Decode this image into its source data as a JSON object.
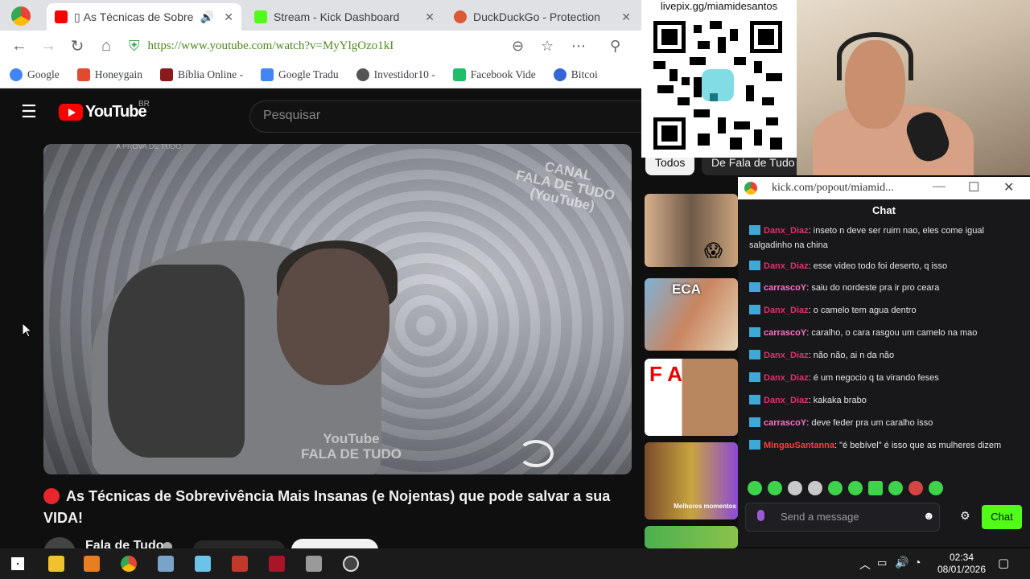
{
  "tabs": [
    {
      "title": "As Técnicas de Sobre",
      "prefix": "▯",
      "icon_color": "#ff0000",
      "active": true
    },
    {
      "title": "Stream - Kick Dashboard",
      "icon_color": "#53fc18"
    },
    {
      "title": "DuckDuckGo - Protection",
      "icon_color": "#de5833"
    }
  ],
  "address": {
    "url": "https://www.youtube.com/watch?v=MyYlgOzo1kI"
  },
  "bookmarks": [
    "Google",
    "Honeygain",
    "Bíblia Online -",
    "Google Tradu",
    "Investidor10 -",
    "Facebook Vide",
    "Bitcoi"
  ],
  "youtube": {
    "logo_text": "YouTube",
    "country": "BR",
    "search_placeholder": "Pesquisar",
    "video_title": "As Técnicas de Sobrevivência Mais Insanas (e Nojentas) que pode salvar a sua VIDA!",
    "channel_name": "Fala de Tudo",
    "watermark_top": "CANAL\nFALA DE TUDO\n(YouTube)",
    "watermark_bottom": "YouTube\nFALA DE TUDO",
    "watermark_corner": "A PROVA DE TUDO",
    "chips": [
      "Todos",
      "De Fala de Tudo"
    ],
    "thumb_labels": [
      "ECA",
      "F A",
      "Melhores momentos"
    ]
  },
  "overlay": {
    "livepix": "livepix.gg/miamidesantos"
  },
  "kick": {
    "url": "kick.com/popout/miamid...",
    "title": "Chat",
    "messages": [
      {
        "user": "Danx_Diaz",
        "color": "#e1306c",
        "text": "inseto n deve ser ruim nao, eles come igual salgadinho na china"
      },
      {
        "user": "Danx_Diaz",
        "color": "#e1306c",
        "text": "esse video todo foi deserto, q isso"
      },
      {
        "user": "carrascoY",
        "color": "#ff6ec7",
        "text": "saiu do nordeste pra ir pro ceara"
      },
      {
        "user": "Danx_Diaz",
        "color": "#e1306c",
        "text": "o camelo tem agua dentro"
      },
      {
        "user": "carrascoY",
        "color": "#ff6ec7",
        "text": "caralho, o cara rasgou um camelo na mao"
      },
      {
        "user": "Danx_Diaz",
        "color": "#e1306c",
        "text": "não não, ai n da não"
      },
      {
        "user": "Danx_Diaz",
        "color": "#e1306c",
        "text": "é um negocio q ta virando feses"
      },
      {
        "user": "Danx_Diaz",
        "color": "#e1306c",
        "text": "kakaka brabo"
      },
      {
        "user": "carrascoY",
        "color": "#ff6ec7",
        "text": "deve feder pra um caralho isso"
      },
      {
        "user": "MingauSantanna",
        "color": "#ff3a3a",
        "text": "\"é bebível\" é isso que as mulheres dizem"
      }
    ],
    "input_placeholder": "Send a message",
    "send_label": "Chat",
    "accent": "#53fc18"
  },
  "taskbar": {
    "time": "02:34",
    "date": "08/01/2026"
  }
}
